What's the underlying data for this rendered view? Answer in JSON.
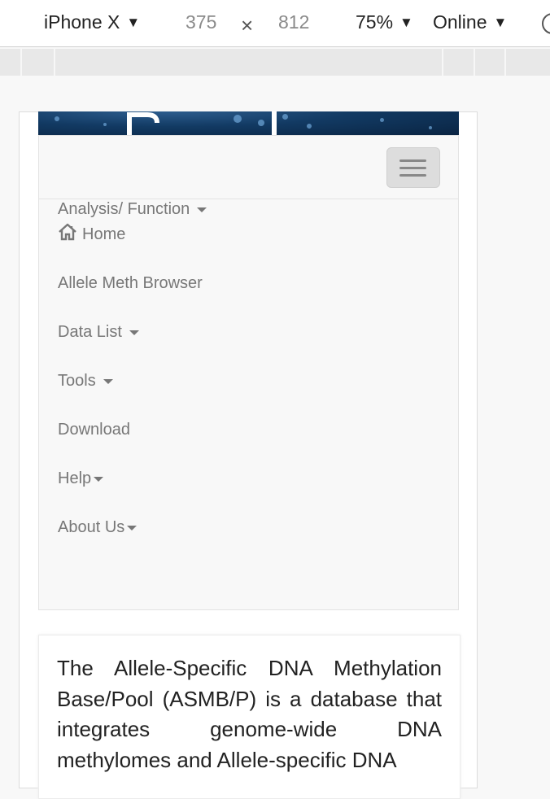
{
  "devtools": {
    "device": "iPhone X",
    "width": "375",
    "times": "×",
    "height": "812",
    "zoom": "75%",
    "network": "Online"
  },
  "nav": {
    "items": [
      {
        "label": "Home",
        "icon": "home-icon"
      },
      {
        "label": "Analysis/ Function",
        "dropdown": true
      },
      {
        "label": "Allele Meth Browser"
      },
      {
        "label": "Data List",
        "dropdown": true
      },
      {
        "label": "Tools",
        "dropdown": true
      },
      {
        "label": "Download"
      },
      {
        "label": "Help",
        "dropdown": true
      },
      {
        "label": "About Us",
        "dropdown": true
      }
    ]
  },
  "intro": {
    "text": "The Allele-Specific DNA Methylation Base/Pool (ASMB/P) is a database that integrates genome-wide DNA methylomes and Allele-specific DNA"
  },
  "colors": {
    "banner": "#123a63",
    "navbar_bg": "#f8f8f8",
    "nav_text": "#777777"
  }
}
